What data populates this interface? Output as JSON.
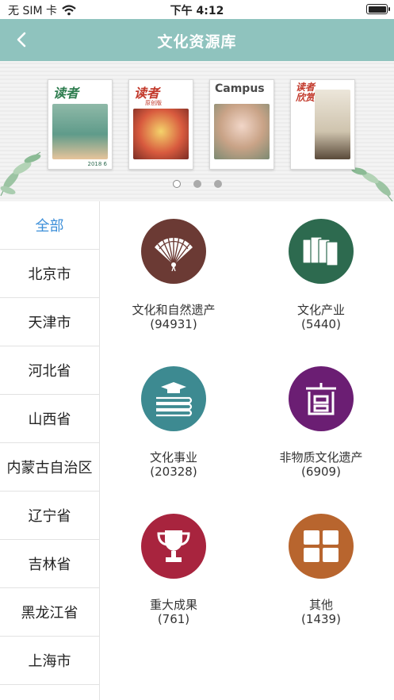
{
  "status_bar": {
    "carrier": "无 SIM 卡",
    "time": "下午 4:12"
  },
  "nav": {
    "title": "文化资源库",
    "back_icon": "chevron-left-icon"
  },
  "banner": {
    "magazines": [
      {
        "masthead": "读者",
        "sub": "",
        "foot": "2018 6",
        "color": "#6aa79a"
      },
      {
        "masthead": "读者",
        "sub": "原创版",
        "foot": "",
        "color": "#c44b3a"
      },
      {
        "masthead": "Campus",
        "sub": "",
        "foot": "08",
        "color": "#b7a27c"
      },
      {
        "masthead": "读者欣赏",
        "sub": "",
        "foot": "",
        "color": "#d6cfc2"
      }
    ],
    "page_count": 3,
    "active_page": 0
  },
  "sidebar": {
    "items": [
      "全部",
      "北京市",
      "天津市",
      "河北省",
      "山西省",
      "内蒙古自治区",
      "辽宁省",
      "吉林省",
      "黑龙江省",
      "上海市"
    ],
    "active_index": 0
  },
  "categories": [
    {
      "name": "文化和自然遗产",
      "count": "(94931)",
      "icon": "folding-fan-icon",
      "color": "#6b3a34"
    },
    {
      "name": "文化产业",
      "count": "(5440)",
      "icon": "books-stack-icon",
      "color": "#2d6a4f"
    },
    {
      "name": "文化事业",
      "count": "(20328)",
      "icon": "books-graduation-cap-icon",
      "color": "#3d8a91"
    },
    {
      "name": "非物质文化遗产",
      "count": "(6909)",
      "icon": "chinese-seal-icon",
      "color": "#6b1e73"
    },
    {
      "name": "重大成果",
      "count": "(761)",
      "icon": "trophy-icon",
      "color": "#a8243e"
    },
    {
      "name": "其他",
      "count": "(1439)",
      "icon": "grid-icon",
      "color": "#b8652e"
    }
  ],
  "colors": {
    "nav_bg": "#8fc3be",
    "active_text": "#3d8fd9"
  }
}
